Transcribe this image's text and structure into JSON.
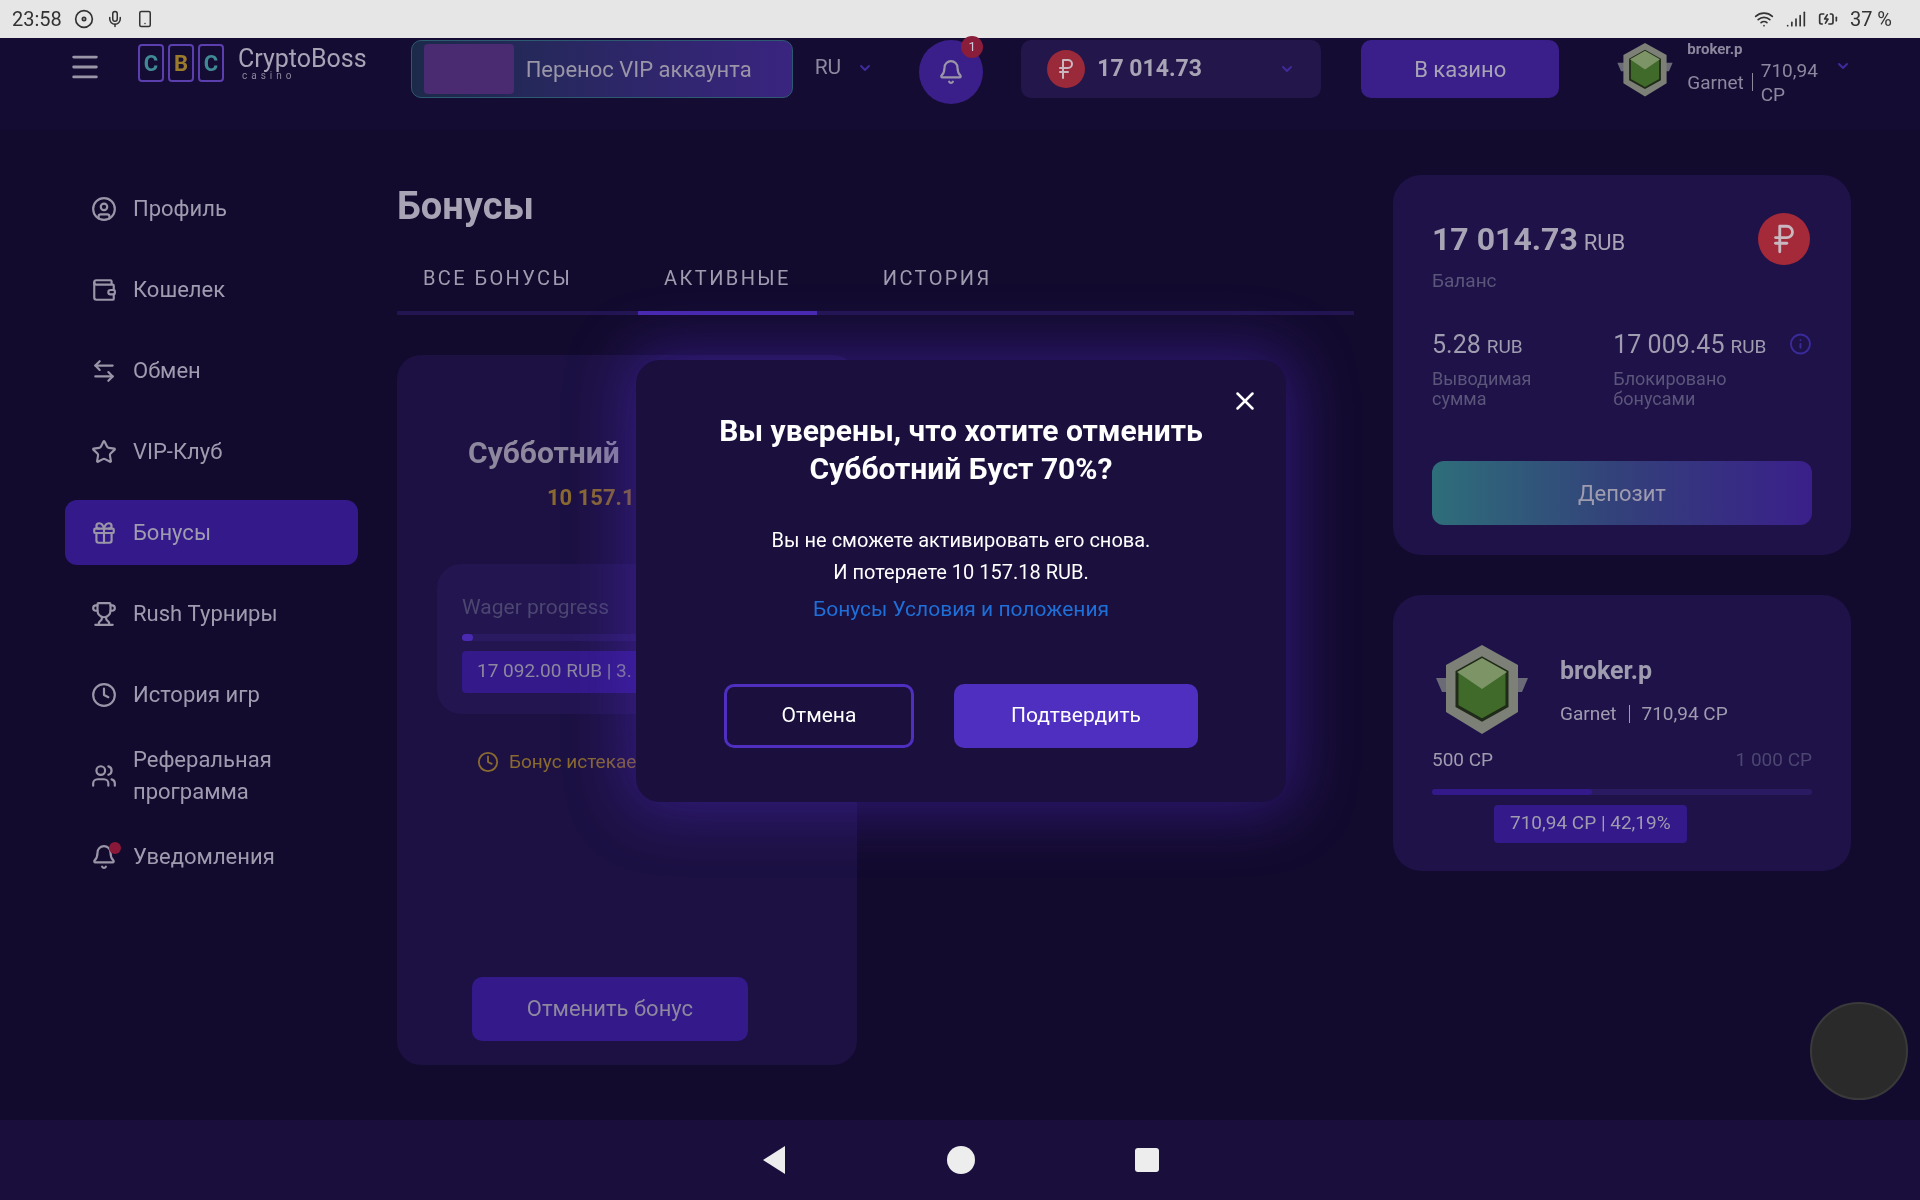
{
  "status_bar": {
    "time": "23:58",
    "battery": "37 %"
  },
  "header": {
    "logo": {
      "letters": [
        "C",
        "B",
        "C"
      ],
      "name": "CryptoBoss",
      "sub": "casino"
    },
    "vip_transfer": "Перенос VIP аккаунта",
    "language": "RU",
    "notifications": {
      "badge": "1"
    },
    "balance": "17 014.73",
    "casino_button": "В казино",
    "user": {
      "name": "broker.p",
      "rank": "Garnet",
      "points": "710,94 CP"
    }
  },
  "sidebar": {
    "items": [
      {
        "label": "Профиль",
        "selected": false,
        "dot": false
      },
      {
        "label": "Кошелек",
        "selected": false,
        "dot": false
      },
      {
        "label": "Обмен",
        "selected": false,
        "dot": false
      },
      {
        "label": "VIP-Клуб",
        "selected": false,
        "dot": false
      },
      {
        "label": "Бонусы",
        "selected": true,
        "dot": false
      },
      {
        "label": "Rush Турниры",
        "selected": false,
        "dot": false
      },
      {
        "label": "История игр",
        "selected": false,
        "dot": false
      },
      {
        "label": "Реферальная программа",
        "selected": false,
        "dot": false
      },
      {
        "label": "Уведомления",
        "selected": false,
        "dot": true
      }
    ]
  },
  "page": {
    "title": "Бонусы",
    "tabs": [
      {
        "label": "ВСЕ БОНУСЫ",
        "selected": false
      },
      {
        "label": "АКТИВНЫЕ",
        "selected": true
      },
      {
        "label": "ИСТОРИЯ",
        "selected": false
      }
    ],
    "bonus_card": {
      "title": "Субботний",
      "amount": "10 157.1",
      "wager_label": "Wager progress",
      "level": 0.03,
      "wager_reading": "17 092.00 RUB | 3.",
      "expiry": "Бонус истекае",
      "cancel_button": "Отменить бонус"
    }
  },
  "wallet": {
    "balance": "17 014.73",
    "currency": "RUB",
    "balance_label": "Баланс",
    "withdrawable": {
      "amount": "5.28",
      "currency": "RUB",
      "label": "Выводимая сумма"
    },
    "blocked": {
      "amount": "17 009.45",
      "currency": "RUB",
      "label": "Блокировано бонусами"
    },
    "deposit_button": "Депозит"
  },
  "vip_card": {
    "name": "broker.p",
    "rank": "Garnet",
    "points": "710,94 CP",
    "min": "500 CP",
    "max": "1 000 CP",
    "level": 0.42,
    "reading": "710,94 CP | 42,19%"
  },
  "modal": {
    "title": "Вы уверены, что хотите отменить Субботний Буст 70%?",
    "lines": [
      "Вы не сможете активировать его снова.",
      "И потеряете 10 157.18 RUB."
    ],
    "link": "Бонусы Условия и положения",
    "cancel_button": "Отмена",
    "confirm_button": "Подтвердить"
  }
}
